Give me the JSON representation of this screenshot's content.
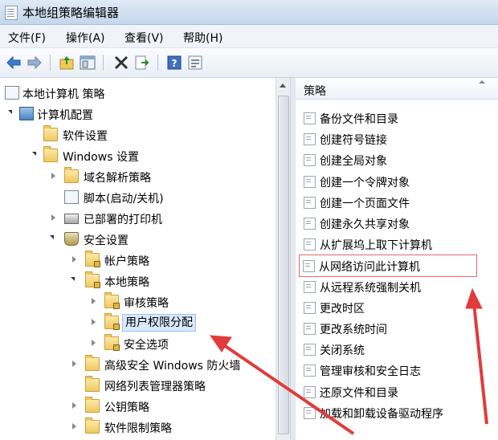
{
  "window": {
    "title": "本地组策略编辑器"
  },
  "menu": [
    "文件(F)",
    "操作(A)",
    "查看(V)",
    "帮助(H)"
  ],
  "toolbar": {
    "icons": [
      "back-arrow-icon",
      "forward-arrow-icon",
      "up-folder-icon",
      "show-hide-tree-icon",
      "delete-icon",
      "export-icon",
      "help-icon",
      "properties-icon"
    ]
  },
  "tree": {
    "root": "本地计算机 策略",
    "computer_config": "计算机配置",
    "software_settings": "软件设置",
    "windows_settings": "Windows 设置",
    "dns_policy": "域名解析策略",
    "scripts": "脚本(启动/关机)",
    "printers": "已部署的打印机",
    "security_settings": "安全设置",
    "account_policy": "帐户策略",
    "local_policy": "本地策略",
    "audit_policy": "审核策略",
    "user_rights": "用户权限分配",
    "security_options": "安全选项",
    "advanced_firewall": "高级安全 Windows 防火墙",
    "network_list": "网络列表管理器策略",
    "public_key": "公钥策略",
    "software_restriction": "软件限制策略"
  },
  "policy_pane": {
    "header": "策略",
    "items": [
      "备份文件和目录",
      "创建符号链接",
      "创建全局对象",
      "创建一个令牌对象",
      "创建一个页面文件",
      "创建永久共享对象",
      "从扩展坞上取下计算机",
      "从网络访问此计算机",
      "从远程系统强制关机",
      "更改时区",
      "更改系统时间",
      "关闭系统",
      "管理审核和安全日志",
      "还原文件和目录",
      "加载和卸载设备驱动程序"
    ],
    "highlighted_index": 7
  },
  "colors": {
    "annotation": "#e23b3b",
    "selection": "#d9e8fb"
  }
}
